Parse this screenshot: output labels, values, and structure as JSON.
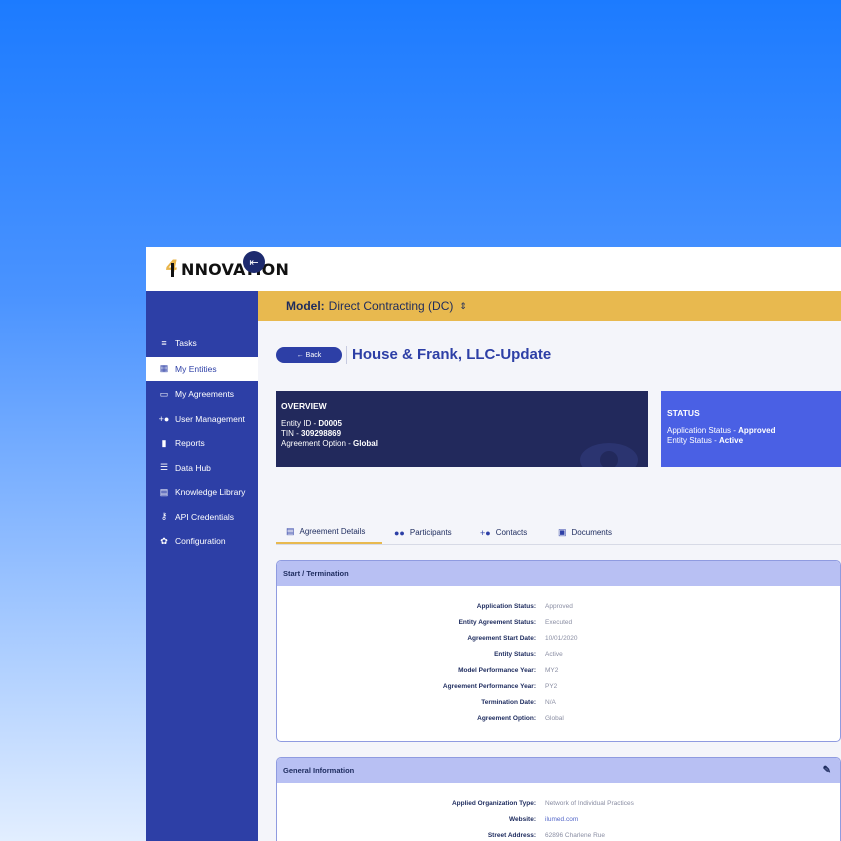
{
  "logo": {
    "text": "NNOVATION",
    "mark": "4"
  },
  "model": {
    "label": "Model:",
    "value": "Direct Contracting (DC)",
    "chevron": "⇕"
  },
  "sidebar": {
    "collapse_icon": "⇤",
    "items": [
      {
        "icon": "≡",
        "label": "Tasks"
      },
      {
        "icon": "▦",
        "label": "My Entities"
      },
      {
        "icon": "▭",
        "label": "My Agreements"
      },
      {
        "icon": "+●",
        "label": "User Management"
      },
      {
        "icon": "▮",
        "label": "Reports"
      },
      {
        "icon": "☰",
        "label": "Data Hub"
      },
      {
        "icon": "▤",
        "label": "Knowledge Library"
      },
      {
        "icon": "⚷",
        "label": "API Credentials"
      },
      {
        "icon": "✿",
        "label": "Configuration"
      }
    ]
  },
  "header": {
    "back_label": "← Back",
    "title": "House & Frank, LLC-Update"
  },
  "overview": {
    "title": "OVERVIEW",
    "entity_id_label": "Entity ID - ",
    "entity_id": "D0005",
    "tin_label": "TIN - ",
    "tin": "309298869",
    "option_label": "Agreement Option - ",
    "option": "Global"
  },
  "status": {
    "title": "STATUS",
    "app_label": "Application Status - ",
    "app_value": "Approved",
    "entity_label": "Entity Status - ",
    "entity_value": "Active"
  },
  "tabs": [
    {
      "icon": "▤",
      "label": "Agreement Details"
    },
    {
      "icon": "●●",
      "label": "Participants"
    },
    {
      "icon": "+●",
      "label": "Contacts"
    },
    {
      "icon": "▣",
      "label": "Documents"
    }
  ],
  "start_termination": {
    "title": "Start / Termination",
    "rows": [
      {
        "label": "Application Status:",
        "value": "Approved"
      },
      {
        "label": "Entity Agreement Status:",
        "value": "Executed"
      },
      {
        "label": "Agreement Start Date:",
        "value": "10/01/2020"
      },
      {
        "label": "Entity Status:",
        "value": "Active"
      },
      {
        "label": "Model Performance Year:",
        "value": "MY2"
      },
      {
        "label": "Agreement Performance Year:",
        "value": "PY2"
      },
      {
        "label": "Termination Date:",
        "value": "N/A"
      },
      {
        "label": "Agreement Option:",
        "value": "Global"
      }
    ]
  },
  "general_information": {
    "title": "General Information",
    "edit_icon": "✎",
    "rows": [
      {
        "label": "Applied Organization Type:",
        "value": "Network of Individual Practices"
      },
      {
        "label": "Website:",
        "value": "ilumed.com"
      },
      {
        "label": "Street Address:",
        "value": "62896 Charlene Rue"
      }
    ]
  }
}
